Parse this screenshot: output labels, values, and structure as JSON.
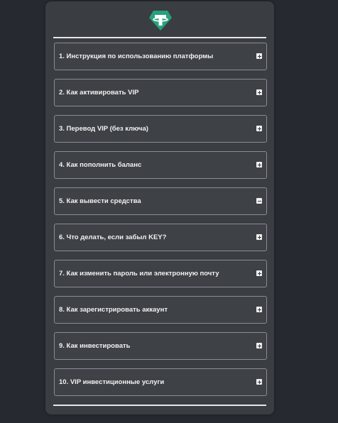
{
  "logo": {
    "icon": "tether-logo-icon",
    "color": "#26a17b"
  },
  "faq": [
    {
      "label": "1. Инструкция по использованию платформы",
      "icon": "plus-icon"
    },
    {
      "label": "2. Как активировать VIP",
      "icon": "plus-icon"
    },
    {
      "label": "3. Перевод VIP (без ключа)",
      "icon": "plus-icon"
    },
    {
      "label": "4. Как пополнить баланс",
      "icon": "plus-icon"
    },
    {
      "label": "5. Как вывести средства",
      "icon": "minus-icon"
    },
    {
      "label": "6. Что делать, если забыл KEY?",
      "icon": "plus-icon"
    },
    {
      "label": "7. Как изменить пароль или электронную почту",
      "icon": "plus-icon"
    },
    {
      "label": "8. Как зарегистрировать аккаунт",
      "icon": "plus-icon"
    },
    {
      "label": "9. Как инвестировать",
      "icon": "plus-icon"
    },
    {
      "label": "10. VIP инвестиционные услуги",
      "icon": "plus-icon"
    }
  ]
}
